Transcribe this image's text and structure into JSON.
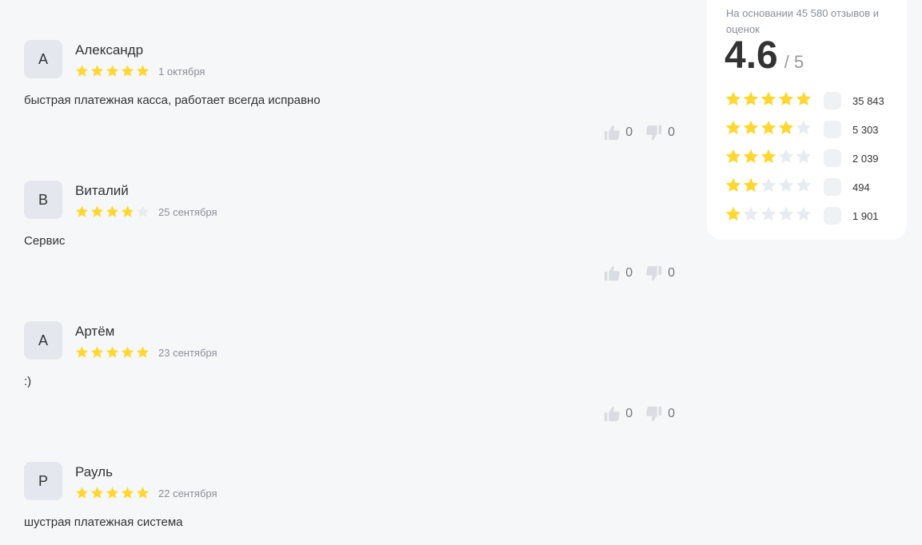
{
  "colors": {
    "star_filled": "#ffd733",
    "star_empty": "#e8ebf0",
    "background": "#f6f7f8",
    "card": "#ffffff"
  },
  "icons": {
    "star": "star-icon",
    "like": "thumbs-up-icon",
    "dislike": "thumbs-down-icon"
  },
  "reviews": [
    {
      "initial": "А",
      "author": "Александр",
      "rating": 5,
      "date": "1 октября",
      "text": "быстрая платежная касса, работает всегда исправно",
      "likes": "0",
      "dislikes": "0"
    },
    {
      "initial": "В",
      "author": "Виталий",
      "rating": 4,
      "date": "25 сентября",
      "text": "Сервис",
      "likes": "0",
      "dislikes": "0"
    },
    {
      "initial": "А",
      "author": "Артём",
      "rating": 5,
      "date": "23 сентября",
      "text": ":)",
      "likes": "0",
      "dislikes": "0"
    },
    {
      "initial": "Р",
      "author": "Рауль",
      "rating": 5,
      "date": "22 сентября",
      "text": "шустрая платежная система",
      "likes": "",
      "dislikes": ""
    }
  ],
  "summary": {
    "caption": "На основании 45 580 отзывов и оценок",
    "score": "4.6",
    "max": "/ 5",
    "distribution": [
      {
        "stars": 5,
        "count": "35 843"
      },
      {
        "stars": 4,
        "count": "5 303"
      },
      {
        "stars": 3,
        "count": "2 039"
      },
      {
        "stars": 2,
        "count": "494"
      },
      {
        "stars": 1,
        "count": "1 901"
      }
    ]
  }
}
